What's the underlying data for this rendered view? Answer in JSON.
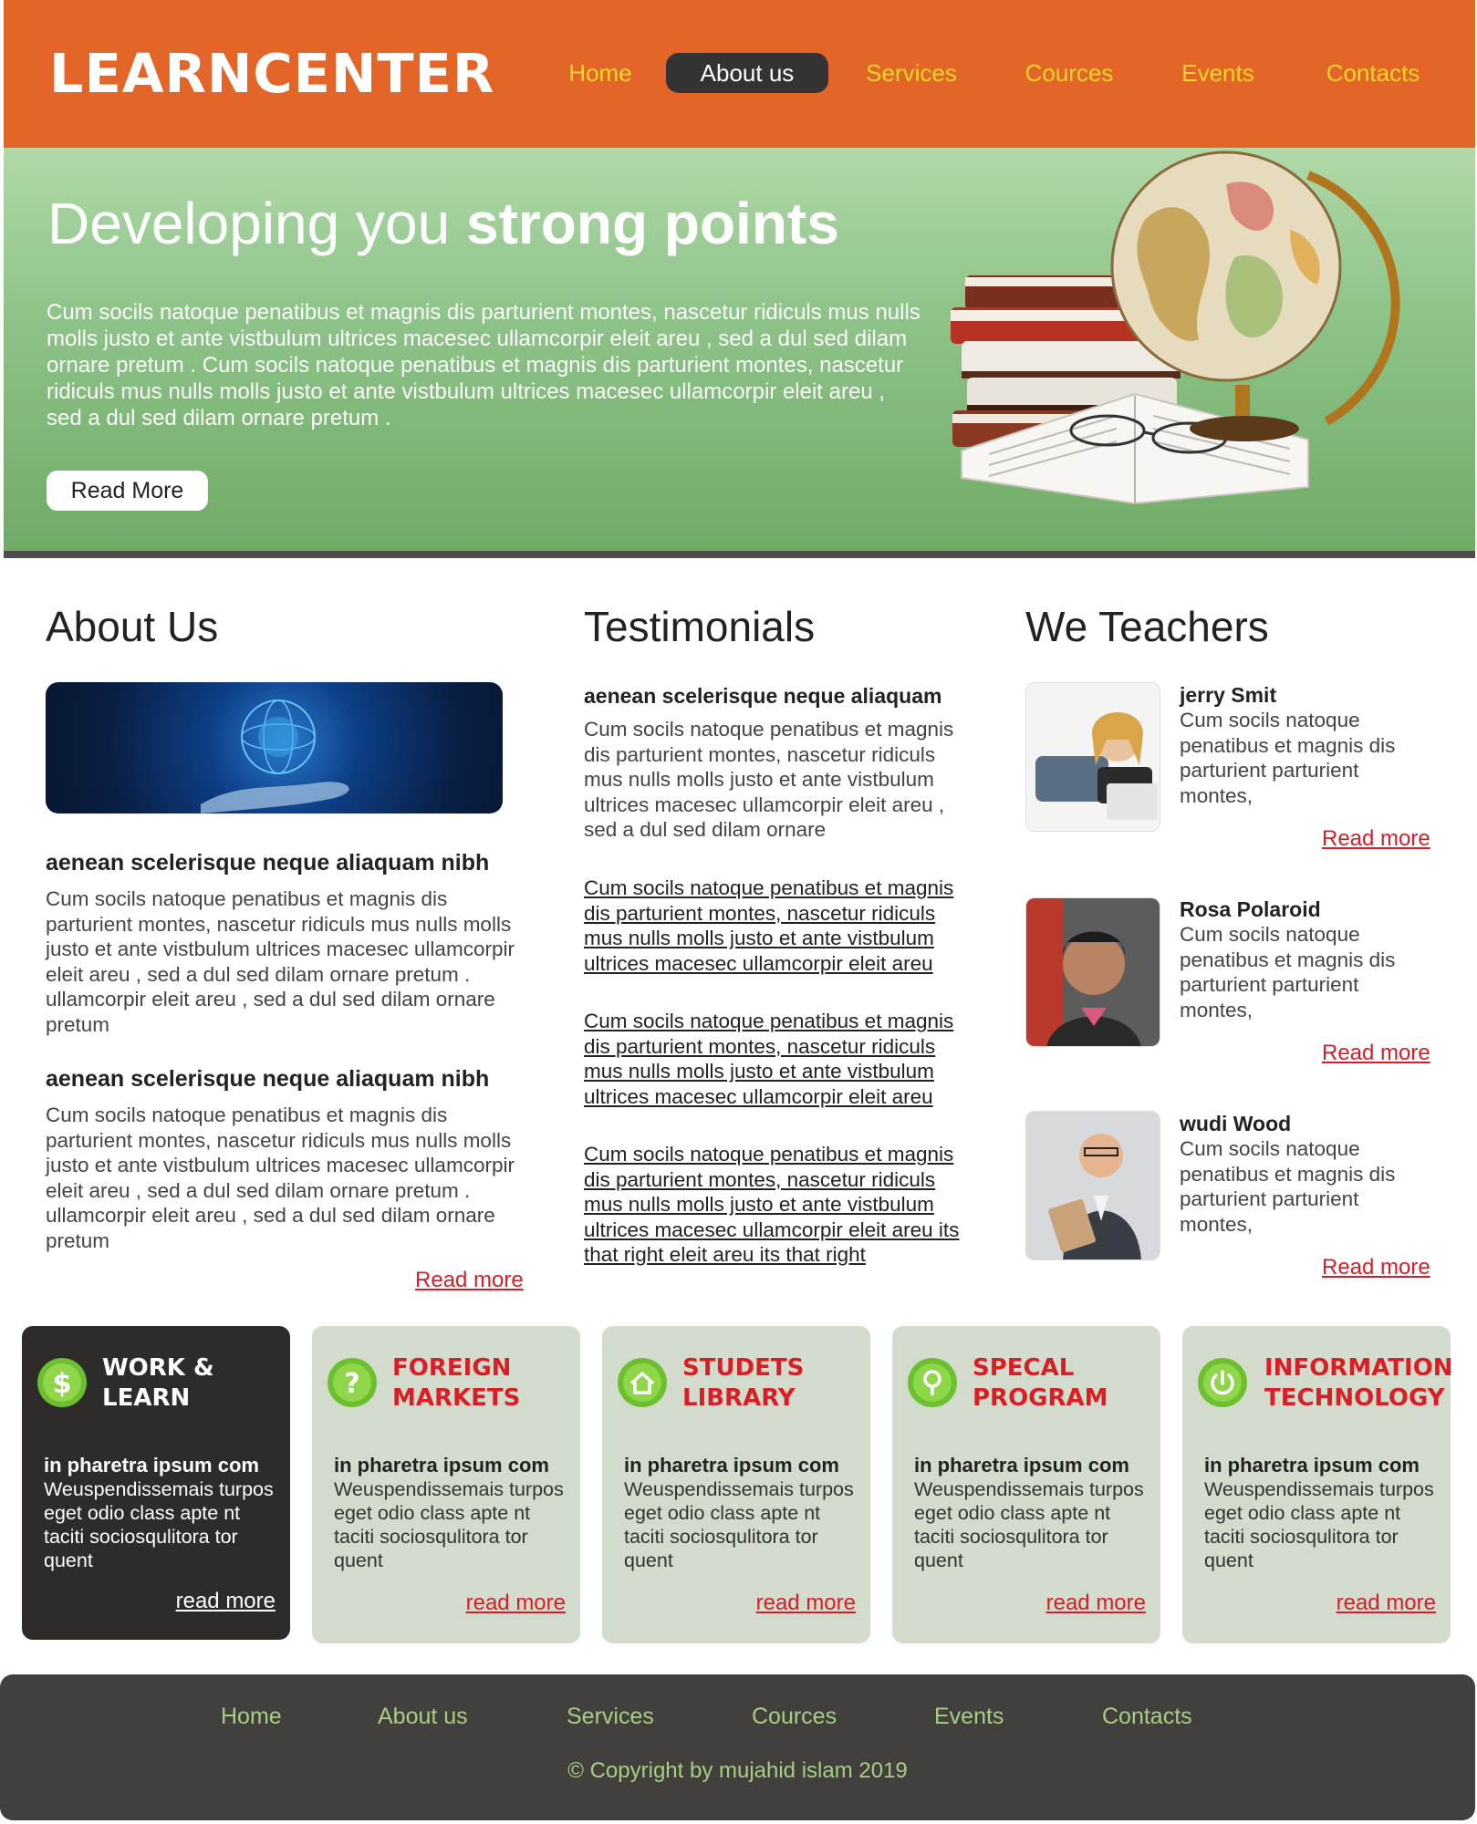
{
  "header": {
    "logo": "LEARNCENTER",
    "nav": [
      "Home",
      "About us",
      "Services",
      "Cources",
      "Events",
      "Contacts"
    ],
    "active_nav": "About us"
  },
  "hero": {
    "title_light": "Developing you ",
    "title_bold": "strong points",
    "text": "Cum socils natoque penatibus et magnis dis parturient montes, nascetur ridiculs mus nulls molls justo et ante vistbulum ultrices macesec ullamcorpir eleit areu , sed a dul sed dilam ornare pretum . Cum socils natoque penatibus et magnis dis parturient montes, nascetur ridiculs mus nulls molls justo et ante vistbulum ultrices macesec ullamcorpir eleit areu , sed a dul sed dilam ornare pretum .",
    "button": "Read More"
  },
  "about": {
    "heading": "About Us",
    "blocks": [
      {
        "subheading": "aenean scelerisque neque aliaquam nibh",
        "text": "Cum socils natoque penatibus et magnis dis parturient montes, nascetur ridiculs mus nulls molls justo et ante vistbulum ultrices macesec ullamcorpir eleit areu , sed a dul sed dilam ornare pretum . ullamcorpir eleit areu , sed a dul sed dilam ornare pretum"
      },
      {
        "subheading": "aenean scelerisque neque aliaquam nibh",
        "text": "Cum socils natoque penatibus et magnis dis parturient montes, nascetur ridiculs mus nulls molls justo et ante vistbulum ultrices macesec ullamcorpir eleit areu , sed a dul sed dilam ornare pretum . ullamcorpir eleit areu , sed a dul sed dilam ornare pretum"
      }
    ],
    "read_more": "Read more"
  },
  "testimonials": {
    "heading": "Testimonials",
    "subheading": "aenean scelerisque neque aliaquam",
    "text": "Cum socils natoque penatibus et magnis dis parturient montes, nascetur ridiculs mus nulls molls justo et ante vistbulum ultrices macesec ullamcorpir eleit areu , sed a dul sed dilam ornare",
    "links": [
      "Cum socils natoque penatibus et magnis dis parturient montes, nascetur ridiculs mus nulls molls justo et ante vistbulum ultrices macesec ullamcorpir eleit areu",
      "Cum socils natoque penatibus et magnis dis parturient montes, nascetur ridiculs mus nulls molls justo et ante vistbulum ultrices macesec ullamcorpir eleit areu",
      "Cum socils natoque penatibus et magnis dis parturient montes, nascetur ridiculs mus nulls molls justo et ante vistbulum ultrices macesec ullamcorpir eleit areu its that right eleit areu its that right"
    ]
  },
  "teachers": {
    "heading": "We Teachers",
    "items": [
      {
        "name": "jerry Smit",
        "text": "Cum socils natoque penatibus et magnis dis parturient parturient montes,",
        "read_more": "Read more"
      },
      {
        "name": "Rosa Polaroid",
        "text": "Cum socils natoque penatibus et magnis dis parturient parturient montes,",
        "read_more": "Read more"
      },
      {
        "name": "wudi Wood",
        "text": "Cum socils natoque penatibus et magnis dis parturient parturient montes,",
        "read_more": "Read more"
      }
    ]
  },
  "features": [
    {
      "title": "WORK &\nLEARN",
      "icon": "dollar-icon",
      "subheading": "in pharetra ipsum com",
      "text": "Weuspendissemais turpos eget odio class apte nt taciti sociosqulitora tor quent",
      "read_more": "read more"
    },
    {
      "title": "FOREIGN\nMARKETS",
      "icon": "question-icon",
      "subheading": "in pharetra ipsum com",
      "text": "Weuspendissemais turpos eget odio class apte nt taciti sociosqulitora tor quent",
      "read_more": "read more"
    },
    {
      "title": "STUDETS\nLIBRARY",
      "icon": "home-icon",
      "subheading": "in pharetra ipsum com",
      "text": "Weuspendissemais turpos eget odio class apte nt taciti sociosqulitora tor quent",
      "read_more": "read more"
    },
    {
      "title": "SPECAL\nPROGRAM",
      "icon": "search-icon",
      "subheading": "in pharetra ipsum com",
      "text": "Weuspendissemais turpos eget odio class apte nt taciti sociosqulitora tor quent",
      "read_more": "read more"
    },
    {
      "title": "INFORMATION\nTECHNOLOGY",
      "icon": "power-icon",
      "subheading": "in pharetra ipsum com",
      "text": "Weuspendissemais turpos eget odio class apte nt taciti sociosqulitora tor quent",
      "read_more": "read more"
    }
  ],
  "footer": {
    "nav": [
      "Home",
      "About us",
      "Services",
      "Cources",
      "Events",
      "Contacts"
    ],
    "copyright": "© Copyright by mujahid islam 2019"
  },
  "colors": {
    "header": "#e36527",
    "nav_text": "#ffd72a",
    "accent_red": "#d2202a",
    "footer": "#433f3c",
    "footer_text": "#a4d084"
  }
}
